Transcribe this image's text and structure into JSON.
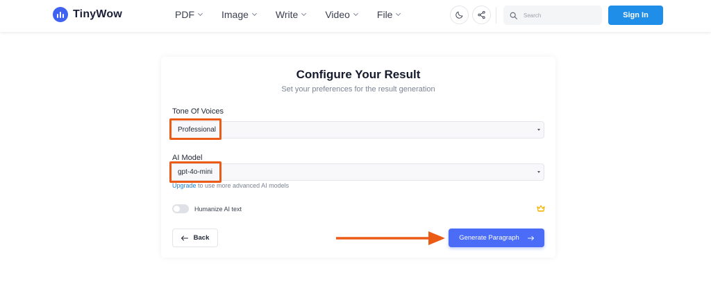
{
  "header": {
    "brand": "TinyWow",
    "nav": [
      {
        "label": "PDF"
      },
      {
        "label": "Image"
      },
      {
        "label": "Write"
      },
      {
        "label": "Video"
      },
      {
        "label": "File"
      }
    ],
    "icons": {
      "theme": "moon-icon",
      "share": "share-icon",
      "search": "search-icon"
    },
    "search_placeholder": "Search",
    "signin_label": "Sign In"
  },
  "card": {
    "title": "Configure Your Result",
    "subtitle": "Set your preferences for the result generation",
    "tone": {
      "label": "Tone Of Voices",
      "value": "Professional"
    },
    "model": {
      "label": "AI Model",
      "value": "gpt-4o-mini"
    },
    "upgrade_link": "Upgrade",
    "upgrade_text": " to use more advanced AI models",
    "humanize_label": "Humanize AI text",
    "humanize_enabled": false,
    "back_label": "Back",
    "generate_label": "Generate Paragraph"
  },
  "colors": {
    "primary": "#4a6cf7",
    "signin": "#1f8ee8",
    "annotation": "#ec5b16",
    "crown": "#f5b400",
    "logo": "#3f63f0"
  }
}
